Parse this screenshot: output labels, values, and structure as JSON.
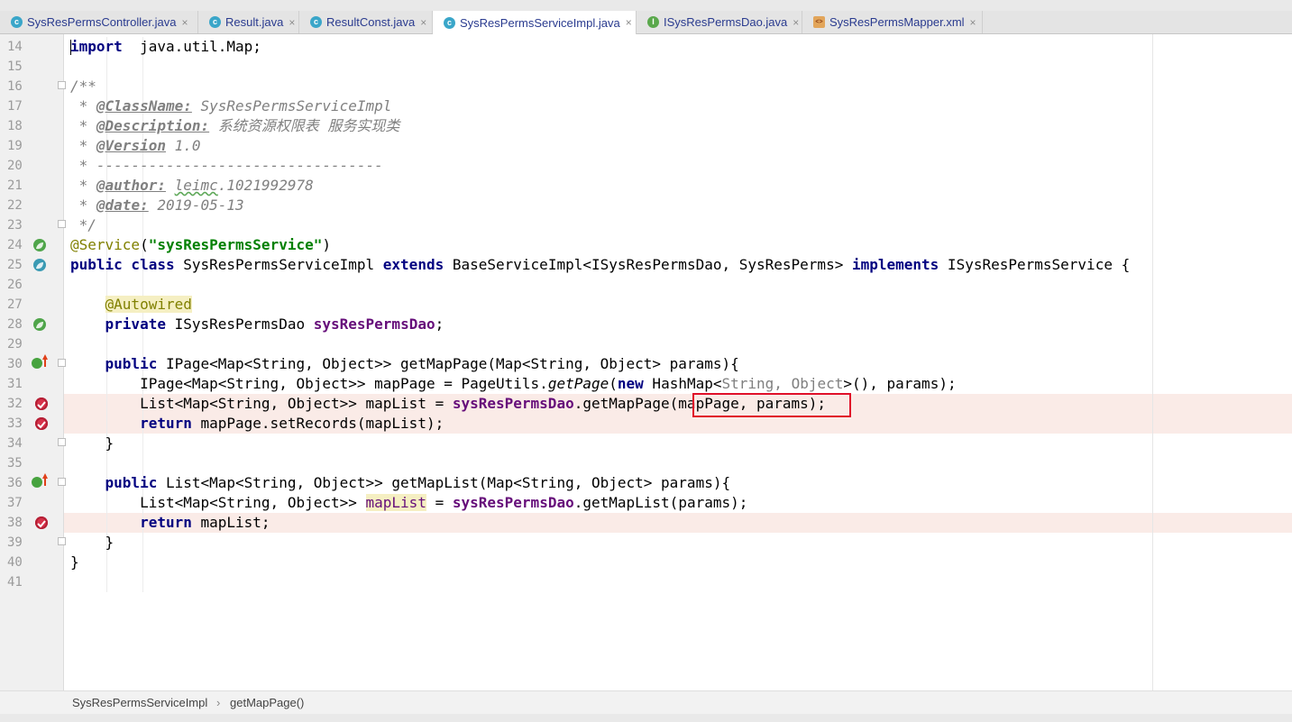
{
  "tabs": [
    {
      "label": "SysResPermsController.java",
      "icon": "c",
      "close": "×"
    },
    {
      "label": "Result.java",
      "icon": "c",
      "close": "×"
    },
    {
      "label": "ResultConst.java",
      "icon": "c",
      "close": "×"
    },
    {
      "label": "SysResPermsServiceImpl.java",
      "icon": "c",
      "close": "×",
      "active": true
    },
    {
      "label": "ISysResPermsDao.java",
      "icon": "i",
      "close": "×"
    },
    {
      "label": "SysResPermsMapper.xml",
      "icon": "x",
      "close": "×"
    }
  ],
  "tab_icon_glyphs": {
    "c": "c",
    "i": "I",
    "x": "<>"
  },
  "line_numbers": [
    "14",
    "15",
    "16",
    "17",
    "18",
    "19",
    "20",
    "21",
    "22",
    "23",
    "24",
    "25",
    "26",
    "27",
    "28",
    "29",
    "30",
    "31",
    "32",
    "33",
    "34",
    "35",
    "36",
    "37",
    "38",
    "39",
    "40",
    "41"
  ],
  "code_lines": [
    [
      [
        "kw",
        "import"
      ],
      [
        "",
        "  java.util.Map;"
      ]
    ],
    [],
    [
      [
        "cm",
        "/**"
      ]
    ],
    [
      [
        "cm",
        " * "
      ],
      [
        "tag",
        "@ClassName:"
      ],
      [
        "cm",
        " SysResPermsServiceImpl"
      ]
    ],
    [
      [
        "cm",
        " * "
      ],
      [
        "tag",
        "@Description:"
      ],
      [
        "cm",
        " 系统资源权限表 服务实现类"
      ]
    ],
    [
      [
        "cm",
        " * "
      ],
      [
        "tag",
        "@Version"
      ],
      [
        "cm",
        " 1.0"
      ]
    ],
    [
      [
        "cm",
        " * ---------------------------------"
      ]
    ],
    [
      [
        "cm",
        " * "
      ],
      [
        "tag",
        "@author:"
      ],
      [
        "cm",
        " "
      ],
      [
        "cm squig",
        "leimc"
      ],
      [
        "cm",
        ".1021992978"
      ]
    ],
    [
      [
        "cm",
        " * "
      ],
      [
        "tag",
        "@date:"
      ],
      [
        "cm",
        " 2019-05-13"
      ]
    ],
    [
      [
        "cm",
        " */"
      ]
    ],
    [
      [
        "ann",
        "@Service"
      ],
      [
        "",
        "("
      ],
      [
        "str",
        "\"sysResPermsService\""
      ],
      [
        "",
        ")"
      ]
    ],
    [
      [
        "kw",
        "public class"
      ],
      [
        "",
        " SysResPermsServiceImpl "
      ],
      [
        "kw",
        "extends"
      ],
      [
        "",
        " BaseServiceImpl<ISysResPermsDao, SysResPerms> "
      ],
      [
        "kw",
        "implements"
      ],
      [
        "",
        " ISysResPermsService {"
      ]
    ],
    [],
    [
      [
        "",
        "    "
      ],
      [
        "annbg",
        "@Autowired"
      ]
    ],
    [
      [
        "",
        "    "
      ],
      [
        "kw",
        "private"
      ],
      [
        "",
        " ISysResPermsDao "
      ],
      [
        "fld",
        "sysResPermsDao"
      ],
      [
        "",
        ";"
      ]
    ],
    [],
    [
      [
        "",
        "    "
      ],
      [
        "kw",
        "public"
      ],
      [
        "",
        " IPage<Map<String, Object>> getMapPage(Map<String, Object> params){"
      ]
    ],
    [
      [
        "",
        "        IPage<Map<String, Object>> mapPage = PageUtils."
      ],
      [
        "it",
        "getPage"
      ],
      [
        "",
        "("
      ],
      [
        "kw",
        "new"
      ],
      [
        "",
        " HashMap<"
      ],
      [
        "gray",
        "String, Object"
      ],
      [
        "",
        ">(), params);"
      ]
    ],
    [
      [
        "",
        "        List<Map<String, Object>> mapList = "
      ],
      [
        "fld",
        "sysResPermsDao"
      ],
      [
        "",
        ".getMapPage(mapPage, params);"
      ]
    ],
    [
      [
        "",
        "        "
      ],
      [
        "kw",
        "return"
      ],
      [
        "",
        " mapPage.setRecords(mapList);"
      ]
    ],
    [
      [
        "",
        "    }"
      ]
    ],
    [],
    [
      [
        "",
        "    "
      ],
      [
        "kw",
        "public"
      ],
      [
        "",
        " List<Map<String, Object>> getMapList(Map<String, Object> params){"
      ]
    ],
    [
      [
        "",
        "        List<Map<String, Object>> "
      ],
      [
        "usage",
        "mapList"
      ],
      [
        "",
        " = "
      ],
      [
        "fld",
        "sysResPermsDao"
      ],
      [
        "",
        ".getMapList(params);"
      ]
    ],
    [
      [
        "",
        "        "
      ],
      [
        "kw",
        "return"
      ],
      [
        "",
        " mapList;"
      ]
    ],
    [
      [
        "",
        "    }"
      ]
    ],
    [
      [
        "",
        "}"
      ]
    ],
    []
  ],
  "highlighted_lines": [
    18,
    19,
    24
  ],
  "breadcrumb": {
    "class_name": "SysResPermsServiceImpl",
    "separator": "›",
    "method": "getMapPage()"
  },
  "colors": {
    "keyword": "#000080",
    "string": "#008000",
    "comment": "#808080",
    "field": "#660e7a",
    "annotation": "#808000",
    "breakpoint": "#d6334a",
    "highlight": "#faebe7",
    "selection_box": "#e0102a"
  }
}
